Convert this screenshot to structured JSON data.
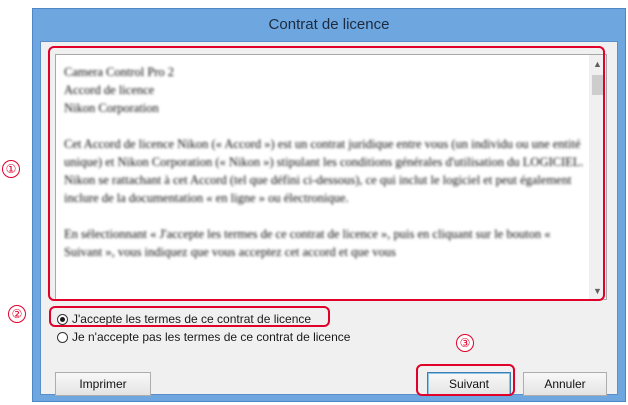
{
  "window": {
    "title": "Contrat de licence"
  },
  "license_text": {
    "paragraphs": [
      "Camera Control Pro 2\nAccord de licence\nNikon Corporation",
      "Cet Accord de licence Nikon (« Accord ») est un contrat juridique entre vous (un individu ou une entité unique) et Nikon Corporation (« Nikon ») stipulant les conditions générales d'utilisation du LOGICIEL. Nikon se rattachant à cet Accord (tel que défini ci-dessous), ce qui inclut le logiciel et peut également inclure de la documentation « en ligne » ou électronique.",
      "En sélectionnant « J'accepte les termes de ce contrat de licence », puis en cliquant sur le bouton « Suivant », vous indiquez que vous acceptez cet accord et que vous"
    ]
  },
  "options": {
    "accept": "J'accepte les termes de ce contrat de licence",
    "decline": "Je n'accepte pas les termes de ce contrat de licence",
    "selected": "accept"
  },
  "buttons": {
    "print": "Imprimer",
    "next": "Suivant",
    "cancel": "Annuler"
  },
  "annotations": {
    "m1": "①",
    "m2": "②",
    "m3": "③"
  },
  "icons": {
    "scroll_up": "scroll-up-icon",
    "scroll_down": "scroll-down-icon"
  },
  "colors": {
    "highlight": "#e0002a",
    "titlebar": "#6ea6e0"
  }
}
